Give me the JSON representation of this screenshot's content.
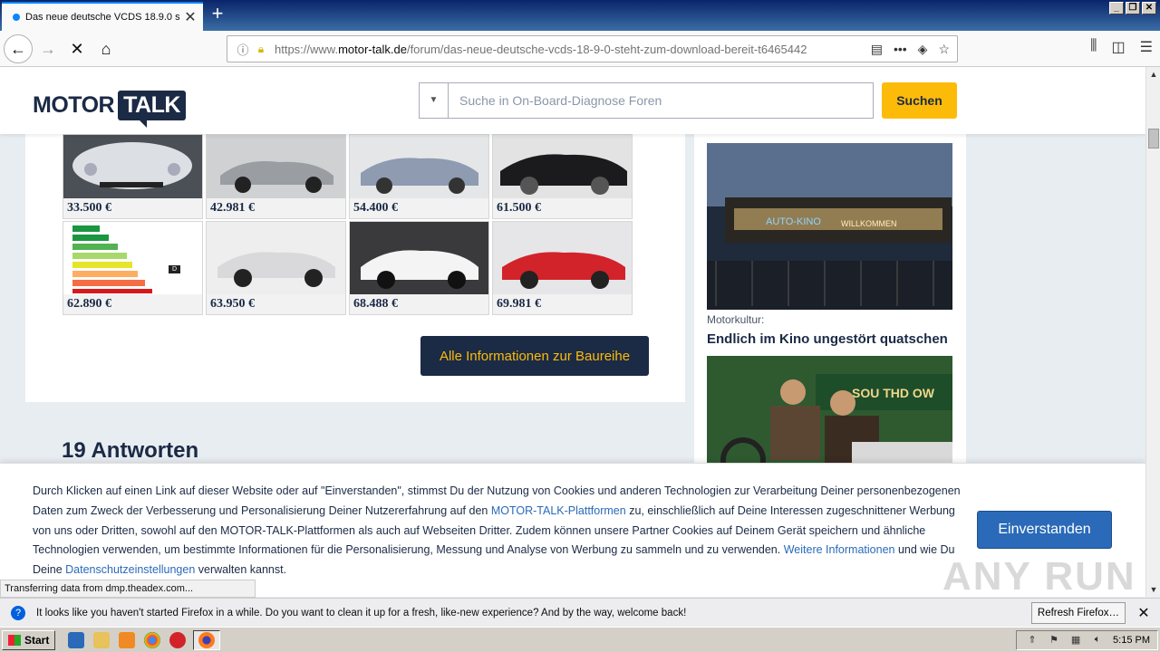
{
  "browser": {
    "tab_title": "Das neue deutsche VCDS 18.9.0 s",
    "new_tab": "+",
    "url_prefix": "https://www.",
    "url_domain": "motor-talk.de",
    "url_path": "/forum/das-neue-deutsche-vcds-18-9-0-steht-zum-download-bereit-t6465442",
    "status_text": "Transferring data from dmp.theadex.com..."
  },
  "site": {
    "logo_motor": "MOTOR",
    "logo_talk": "TALK",
    "search_placeholder": "Suche in On-Board-Diagnose Foren",
    "search_button": "Suchen"
  },
  "cars": [
    {
      "price": "33.500 €",
      "color": "#dcdfe3"
    },
    {
      "price": "42.981 €",
      "color": "#9a9da2"
    },
    {
      "price": "54.400 €",
      "color": "#8e9bb0"
    },
    {
      "price": "61.500 €",
      "color": "#1b1b1e"
    },
    {
      "price": "62.890 €",
      "color": "#ffffff"
    },
    {
      "price": "63.950 €",
      "color": "#e9e9eb"
    },
    {
      "price": "68.488 €",
      "color": "#f4f4f4"
    },
    {
      "price": "69.981 €",
      "color": "#d2232a"
    }
  ],
  "energy_label": {
    "rating": "D"
  },
  "info_button": "Alle Informationen zur Baureihe",
  "answers_heading": "19 Antworten",
  "teaser": {
    "category": "Motorkultur:",
    "title": "Endlich im Kino ungestört quatschen",
    "image1_text": "AUTO-KINO",
    "image1_text2": "WILLKOMMEN",
    "image2_text": "SOU THD OW"
  },
  "cookie": {
    "text_1": "Durch Klicken auf einen Link auf dieser Website oder auf \"Einverstanden\", stimmst Du der Nutzung von Cookies und anderen Technologien zur Verarbeitung Deiner personenbezogenen Daten zum Zweck der Verbesserung und Personalisierung Deiner Nutzererfahrung auf den ",
    "link_1": "MOTOR-TALK-Plattformen",
    "text_2": " zu, einschließlich auf Deine Interessen zugeschnittener Werbung von uns oder Dritten, sowohl auf den MOTOR-TALK-Plattformen als auch auf Webseiten Dritter. Zudem können unsere Partner Cookies auf Deinem Gerät speichern und ähnliche Technologien verwenden, um bestimmte Informationen für die Personalisierung, Messung und Analyse von Werbung zu sammeln und zu verwenden. ",
    "link_2": "Weitere Informationen",
    "text_3": " und wie Du Deine ",
    "link_3": "Datenschutzeinstellungen",
    "text_4": " verwalten kannst.",
    "button": "Einverstanden",
    "watermark": "ANY RUN"
  },
  "notification": {
    "text": "It looks like you haven't started Firefox in a while. Do you want to clean it up for a fresh, like-new experience? And by the way, welcome back!",
    "button": "Refresh Firefox…"
  },
  "taskbar": {
    "start": "Start",
    "clock": "5:15 PM"
  }
}
